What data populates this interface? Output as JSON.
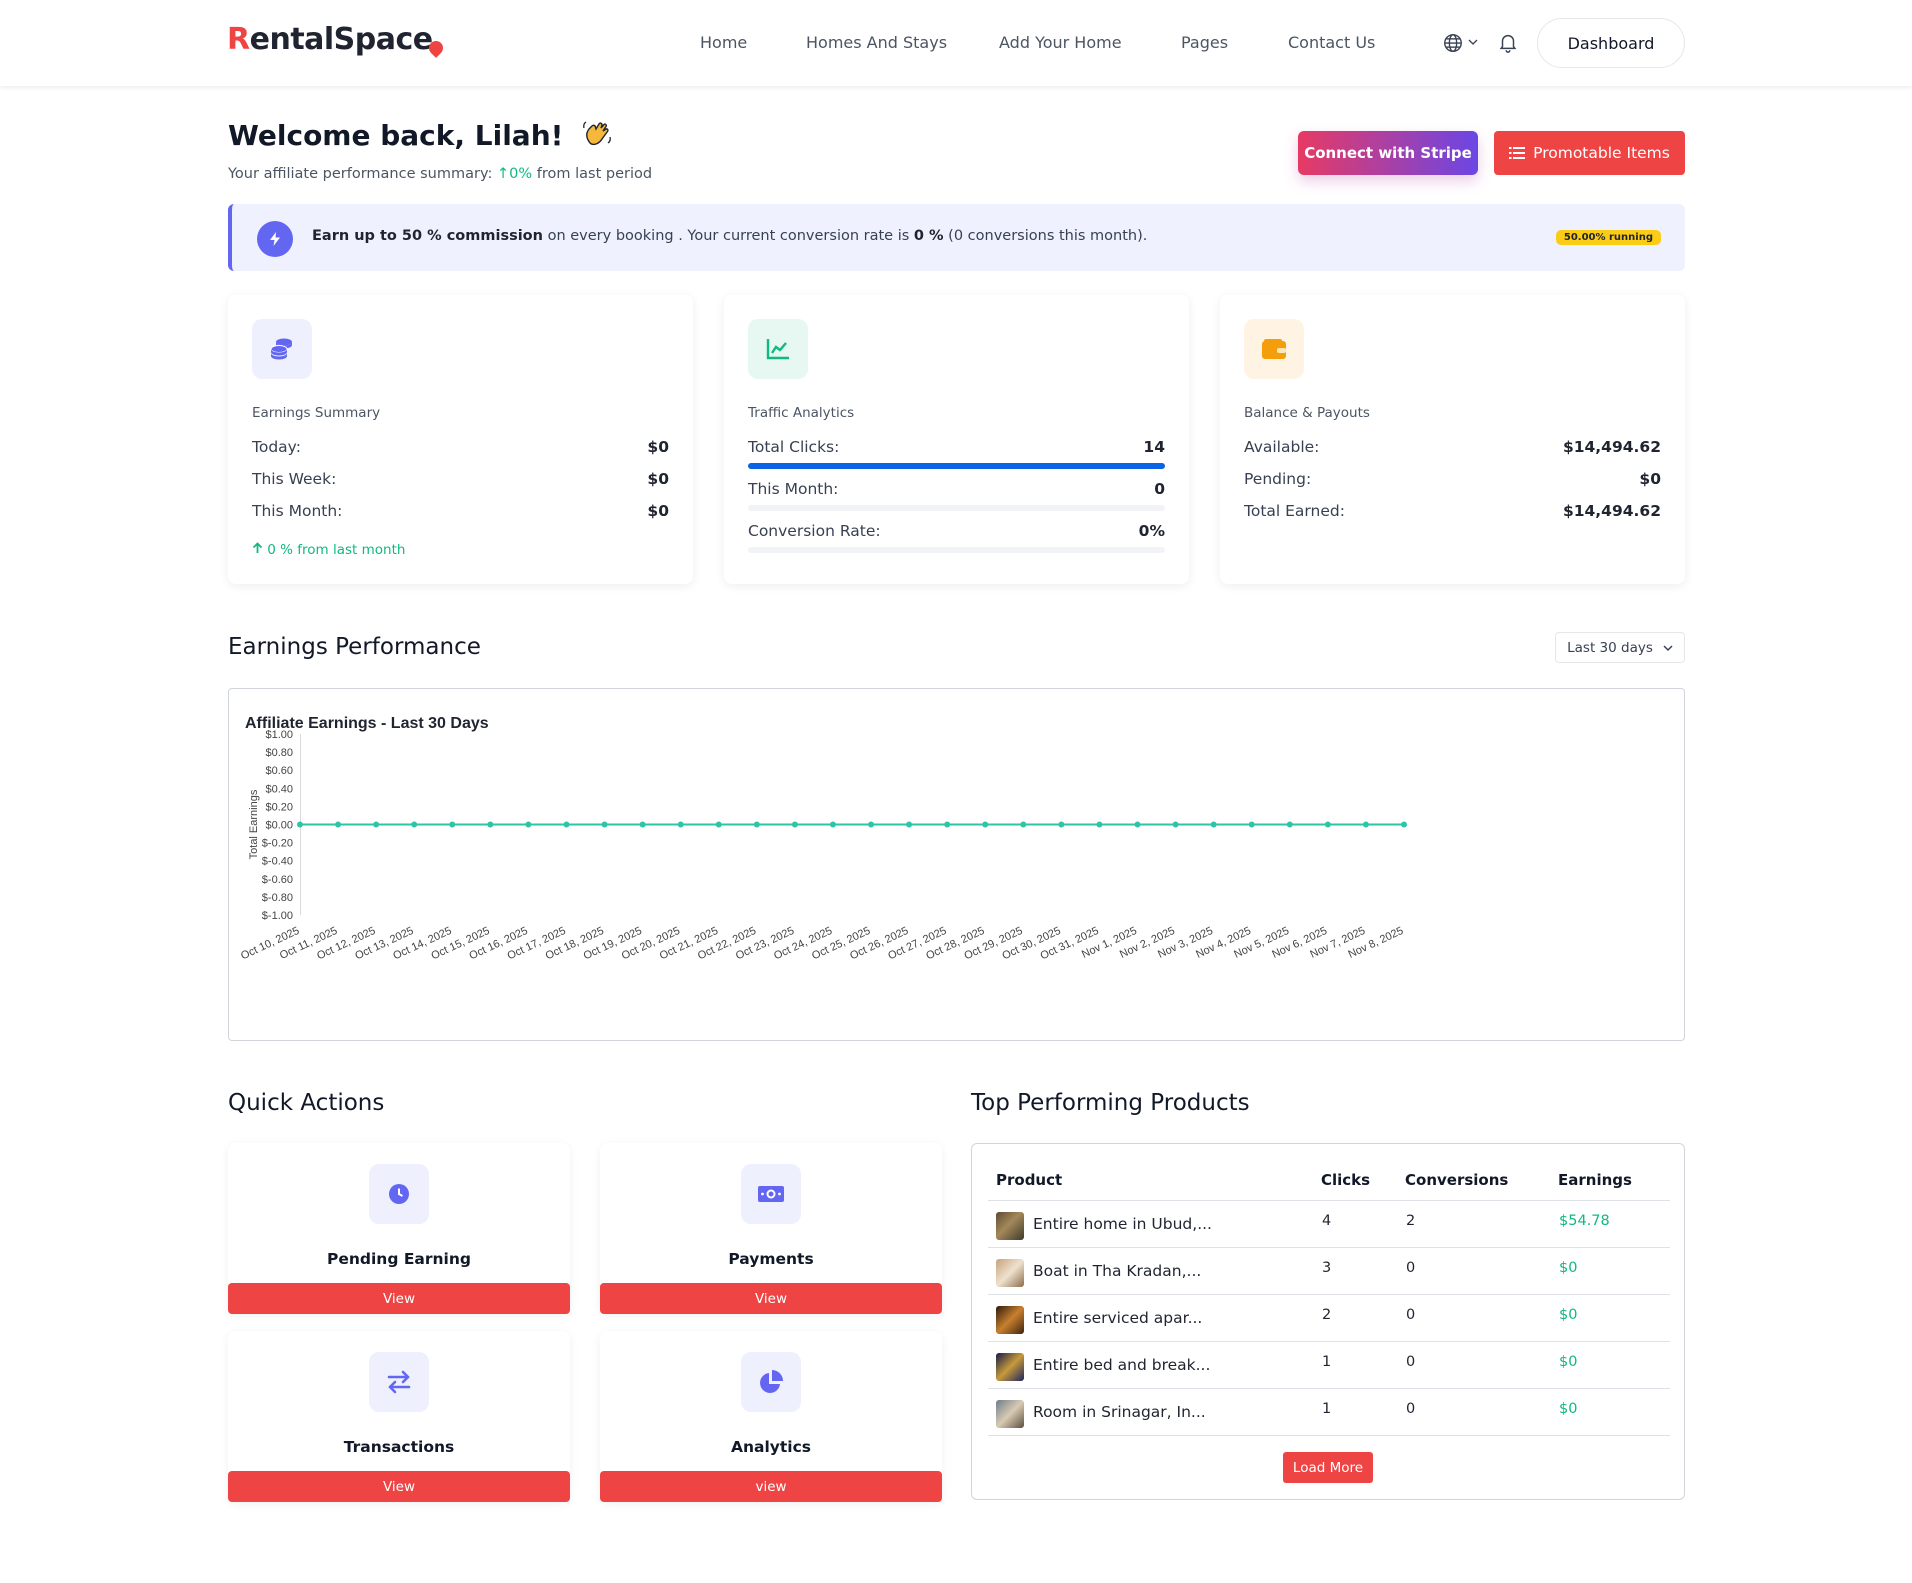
{
  "header": {
    "logo": {
      "first": "R",
      "rest": "entalSpac",
      "last": "e"
    },
    "nav": [
      "Home",
      "Homes And Stays",
      "Add Your Home",
      "Pages",
      "Contact Us"
    ],
    "dashboard_label": "Dashboard",
    "icons": [
      "globe-icon",
      "chevron-down-icon",
      "bell-icon"
    ]
  },
  "welcome": {
    "title": "Welcome back, Lilah!",
    "summary_prefix": "Your affiliate performance summary:",
    "summary_arrow": "↑",
    "summary_value": "0%",
    "summary_suffix": "from last period"
  },
  "actions": {
    "stripe": "Connect with Stripe",
    "promotable": "Promotable Items"
  },
  "banner": {
    "bold1": "Earn up to 50 % commission",
    "text1": " on every booking . Your current conversion rate is ",
    "bold2": "0 %",
    "text2": " (0 conversions this month).",
    "badge": "50.00% running"
  },
  "cards": {
    "earnings": {
      "title": "Earnings Summary",
      "rows": [
        {
          "label": "Today:",
          "value": "$0"
        },
        {
          "label": "This Week:",
          "value": "$0"
        },
        {
          "label": "This Month:",
          "value": "$0"
        }
      ],
      "trend": "0 % from last month"
    },
    "traffic": {
      "title": "Traffic Analytics",
      "rows": [
        {
          "label": "Total Clicks:",
          "value": "14",
          "fill": 1.0
        },
        {
          "label": "This Month:",
          "value": "0",
          "fill": 0
        },
        {
          "label": "Conversion Rate:",
          "value": "0%",
          "fill": 0
        }
      ]
    },
    "balance": {
      "title": "Balance & Payouts",
      "rows": [
        {
          "label": "Available:",
          "value": "$14,494.62"
        },
        {
          "label": "Pending:",
          "value": "$0"
        },
        {
          "label": "Total Earned:",
          "value": "$14,494.62"
        }
      ]
    }
  },
  "performance": {
    "title": "Earnings Performance",
    "range": "Last 30 days"
  },
  "chart_data": {
    "type": "line",
    "title": "Affiliate Earnings - Last 30 Days",
    "ylabel": "Total Earnings",
    "xlabel": "",
    "ylim": [
      -1,
      1
    ],
    "yticks": [
      "$1.00",
      "$0.80",
      "$0.60",
      "$0.40",
      "$0.20",
      "$0.00",
      "$-0.20",
      "$-0.40",
      "$-0.60",
      "$-0.80",
      "$-1.00"
    ],
    "categories": [
      "Oct 10, 2025",
      "Oct 11, 2025",
      "Oct 12, 2025",
      "Oct 13, 2025",
      "Oct 14, 2025",
      "Oct 15, 2025",
      "Oct 16, 2025",
      "Oct 17, 2025",
      "Oct 18, 2025",
      "Oct 19, 2025",
      "Oct 20, 2025",
      "Oct 21, 2025",
      "Oct 22, 2025",
      "Oct 23, 2025",
      "Oct 24, 2025",
      "Oct 25, 2025",
      "Oct 26, 2025",
      "Oct 27, 2025",
      "Oct 28, 2025",
      "Oct 29, 2025",
      "Oct 30, 2025",
      "Oct 31, 2025",
      "Nov 1, 2025",
      "Nov 2, 2025",
      "Nov 3, 2025",
      "Nov 4, 2025",
      "Nov 5, 2025",
      "Nov 6, 2025",
      "Nov 7, 2025",
      "Nov 8, 2025"
    ],
    "values": [
      0,
      0,
      0,
      0,
      0,
      0,
      0,
      0,
      0,
      0,
      0,
      0,
      0,
      0,
      0,
      0,
      0,
      0,
      0,
      0,
      0,
      0,
      0,
      0,
      0,
      0,
      0,
      0,
      0,
      0
    ],
    "color": "#2ec4a6"
  },
  "quick_actions": {
    "title": "Quick Actions",
    "items": [
      {
        "label": "Pending Earning",
        "button": "View",
        "icon": "clock-icon"
      },
      {
        "label": "Payments",
        "button": "View",
        "icon": "money-icon"
      },
      {
        "label": "Transactions",
        "button": "View",
        "icon": "exchange-icon"
      },
      {
        "label": "Analytics",
        "button": "view",
        "icon": "pie-chart-icon"
      }
    ]
  },
  "products": {
    "title": "Top Performing Products",
    "headers": [
      "Product",
      "Clicks",
      "Conversions",
      "Earnings"
    ],
    "rows": [
      {
        "name": "Entire home in Ubud,...",
        "clicks": "4",
        "conversions": "2",
        "earnings": "$54.78"
      },
      {
        "name": "Boat in Tha Kradan,...",
        "clicks": "3",
        "conversions": "0",
        "earnings": "$0"
      },
      {
        "name": "Entire serviced apar...",
        "clicks": "2",
        "conversions": "0",
        "earnings": "$0"
      },
      {
        "name": "Entire bed and break...",
        "clicks": "1",
        "conversions": "0",
        "earnings": "$0"
      },
      {
        "name": "Room in Srinagar, In...",
        "clicks": "1",
        "conversions": "0",
        "earnings": "$0"
      }
    ],
    "load_more": "Load More"
  },
  "colors": {
    "brand_red": "#ef4444",
    "accent_purple": "#6366f1",
    "success_green": "#10b981",
    "progress_blue": "#0b63e5"
  }
}
